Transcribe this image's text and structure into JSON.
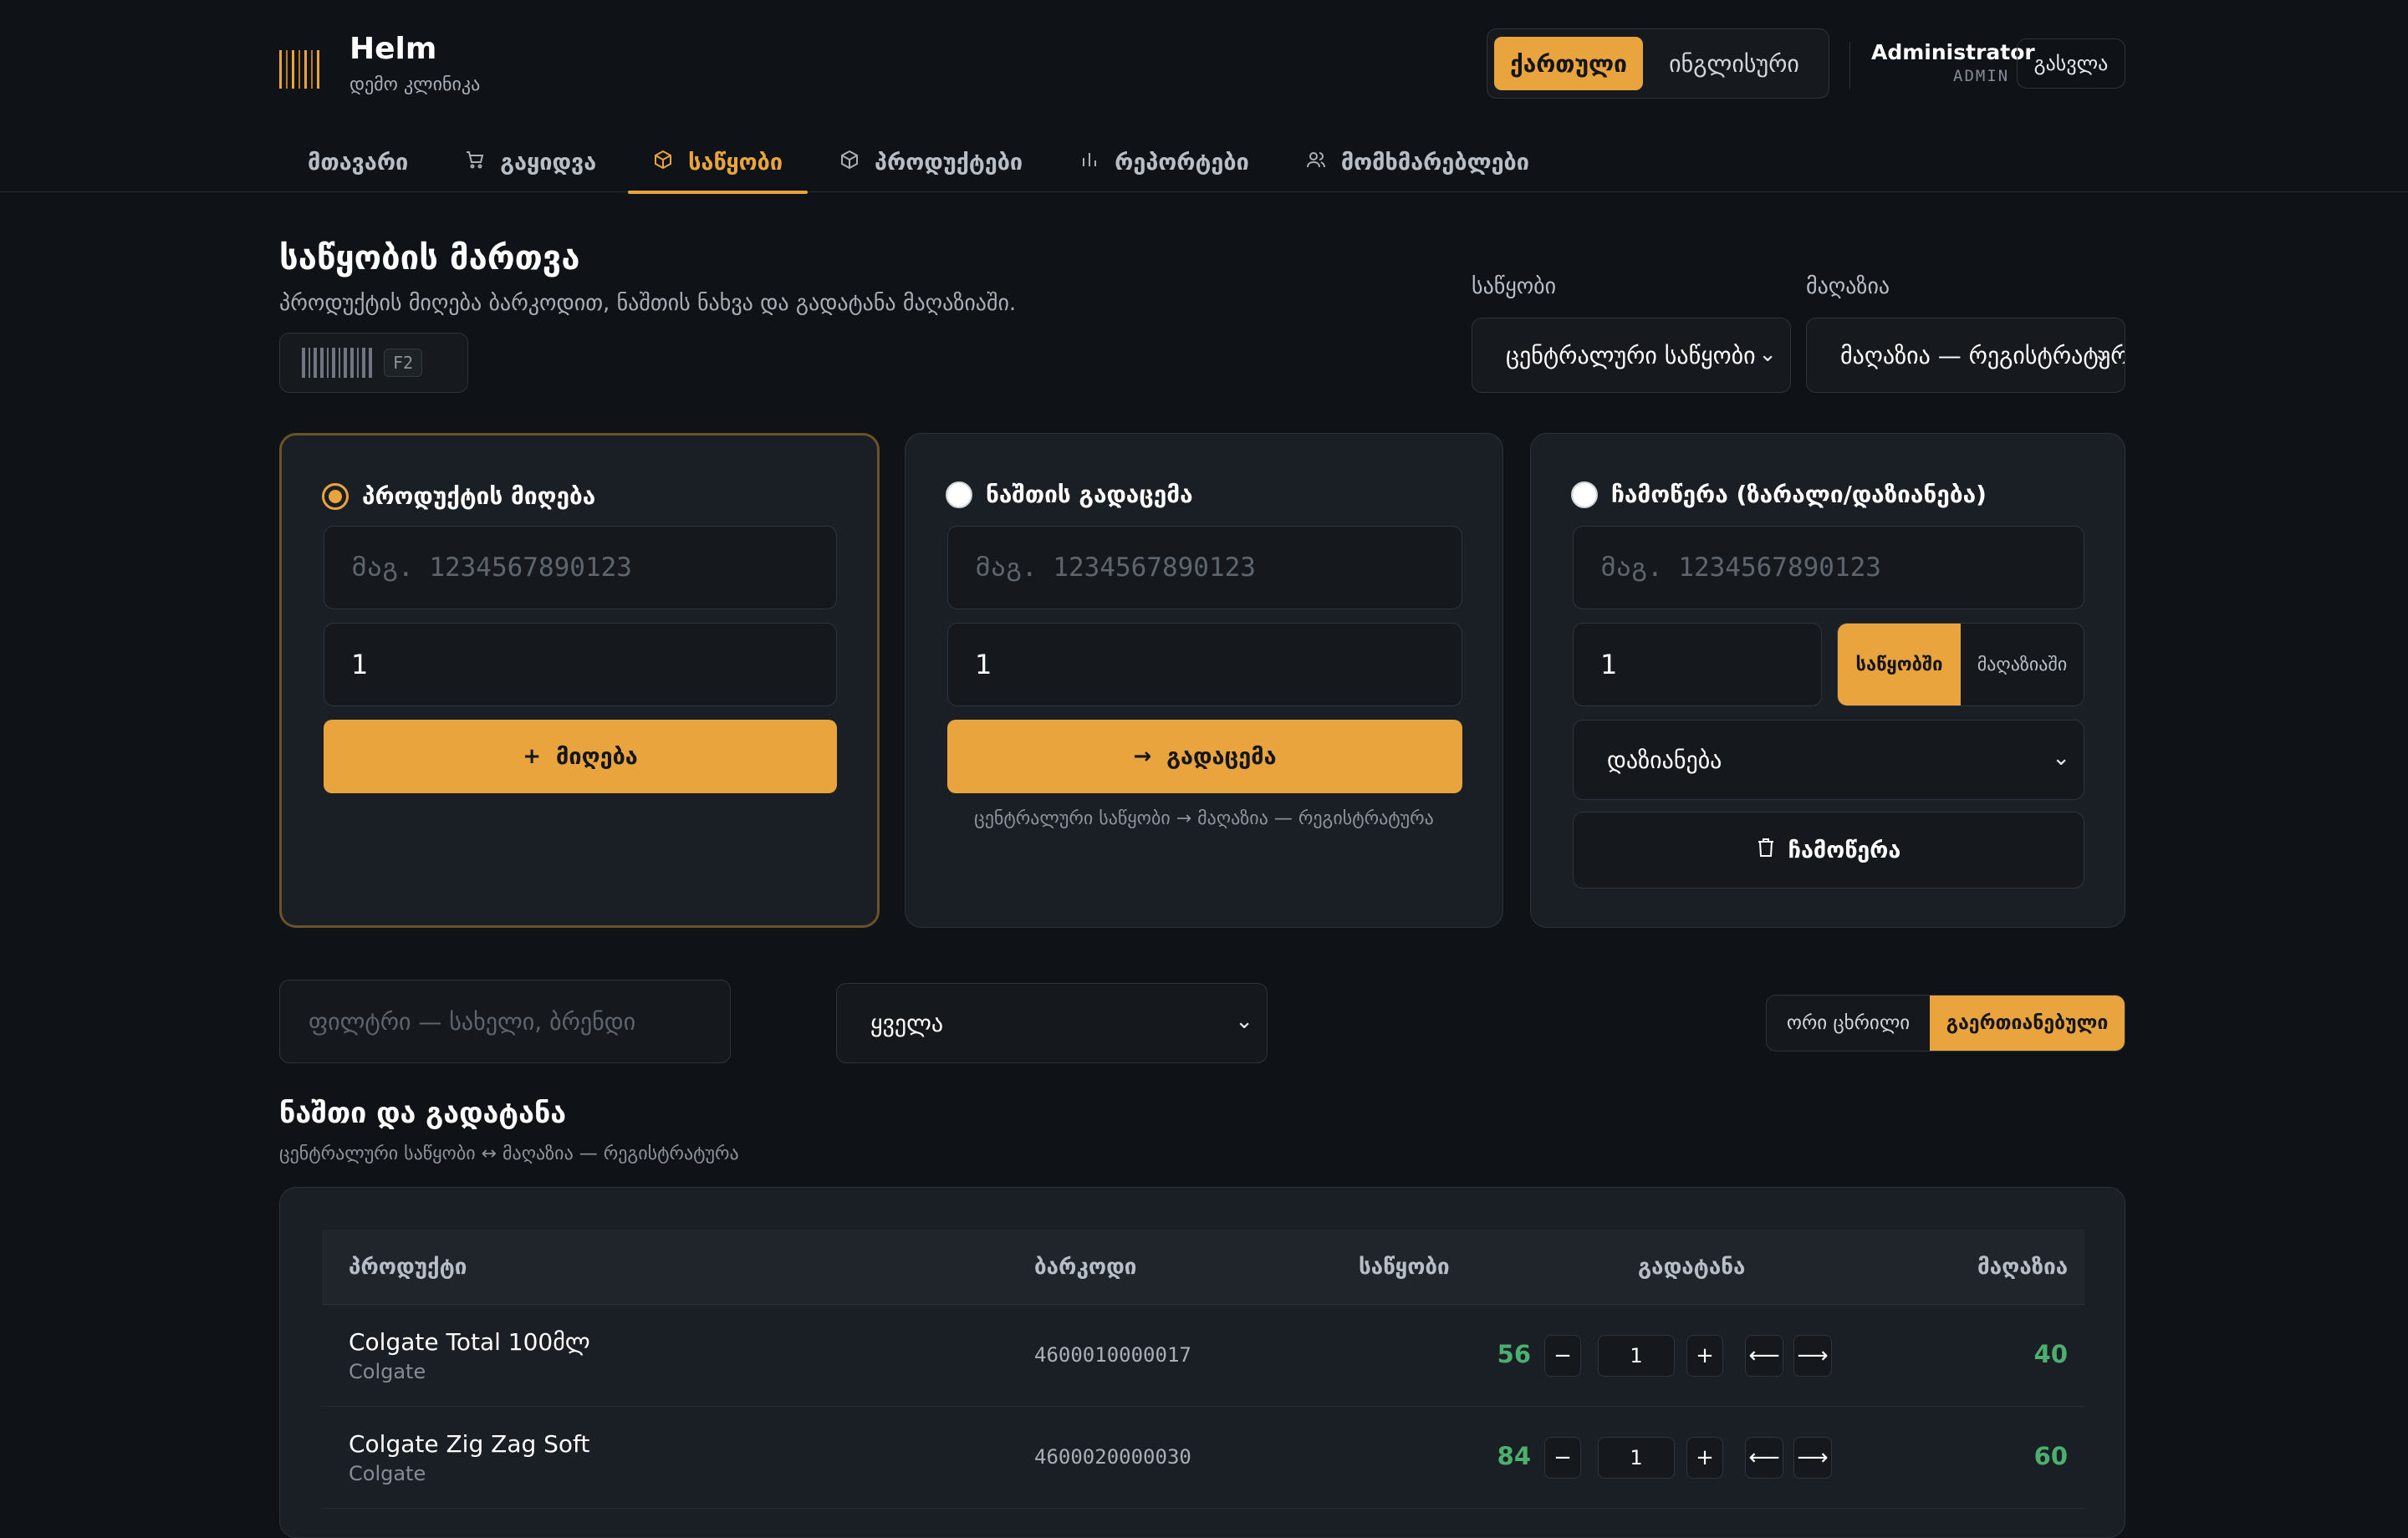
{
  "app": {
    "name": "Helm",
    "subtitle": "დემო კლინიკა"
  },
  "language": {
    "active": "ქართული",
    "other": "ინგლისური"
  },
  "user": {
    "name": "Administrator",
    "role": "ADMIN",
    "logout": "გასვლა"
  },
  "nav": {
    "items": [
      {
        "label": "მთავარი",
        "icon": "none",
        "active": false
      },
      {
        "label": "გაყიდვა",
        "icon": "cart-icon",
        "active": false
      },
      {
        "label": "საწყობი",
        "icon": "box-icon",
        "active": true
      },
      {
        "label": "პროდუქტები",
        "icon": "box-icon",
        "active": false
      },
      {
        "label": "რეპორტები",
        "icon": "bar-chart-icon",
        "active": false
      },
      {
        "label": "მომხმარებლები",
        "icon": "users-icon",
        "active": false
      }
    ]
  },
  "page": {
    "title": "საწყობის მართვა",
    "subtitle": "პროდუქტის მიღება ბარკოდით, ნაშთის ნახვა და გადატანა მაღაზიაში.",
    "scan_key": "F2"
  },
  "selectors": {
    "warehouse_label": "საწყობი",
    "warehouse_value": "ცენტრალური საწყობი",
    "store_label": "მაღაზია",
    "store_value": "მაღაზია — რეგისტრატურა"
  },
  "cards": {
    "receive": {
      "title": "პროდუქტის მიღება",
      "barcode_placeholder": "მაგ. 1234567890123",
      "qty": "1",
      "button": "მიღება"
    },
    "transfer": {
      "title": "ნაშთის გადაცემა",
      "barcode_placeholder": "მაგ. 1234567890123",
      "qty": "1",
      "button": "გადაცემა",
      "route": "ცენტრალური საწყობი → მაღაზია — რეგისტრატურა"
    },
    "writeoff": {
      "title": "ჩამოწერა (ზარალი/დაზიანება)",
      "barcode_placeholder": "მაგ. 1234567890123",
      "qty": "1",
      "loc_warehouse": "საწყობში",
      "loc_store": "მაღაზიაში",
      "reason": "დაზიანება",
      "button": "ჩამოწერა"
    }
  },
  "filters": {
    "search_placeholder": "ფილტრი — სახელი, ბრენდი",
    "category": "ყველა",
    "view_two": "ორი ცხრილი",
    "view_merged": "გაერთიანებული"
  },
  "section": {
    "title": "ნაშთი და გადატანა",
    "subtitle": "ცენტრალური საწყობი ↔ მაღაზია — რეგისტრატურა"
  },
  "table": {
    "headers": {
      "product": "პროდუქტი",
      "barcode": "ბარკოდი",
      "warehouse": "საწყობი",
      "transfer": "გადატანა",
      "store": "მაღაზია"
    },
    "rows": [
      {
        "name": "Colgate Total 100მლ",
        "brand": "Colgate",
        "barcode": "4600010000017",
        "warehouse": "56",
        "qty": "1",
        "store": "40"
      },
      {
        "name": "Colgate Zig Zag Soft",
        "brand": "Colgate",
        "barcode": "4600020000030",
        "warehouse": "84",
        "qty": "1",
        "store": "60"
      }
    ]
  },
  "colors": {
    "accent": "#e9a43d",
    "background": "#0f1216",
    "card": "#1a1f26",
    "positive": "#4caf6e"
  }
}
